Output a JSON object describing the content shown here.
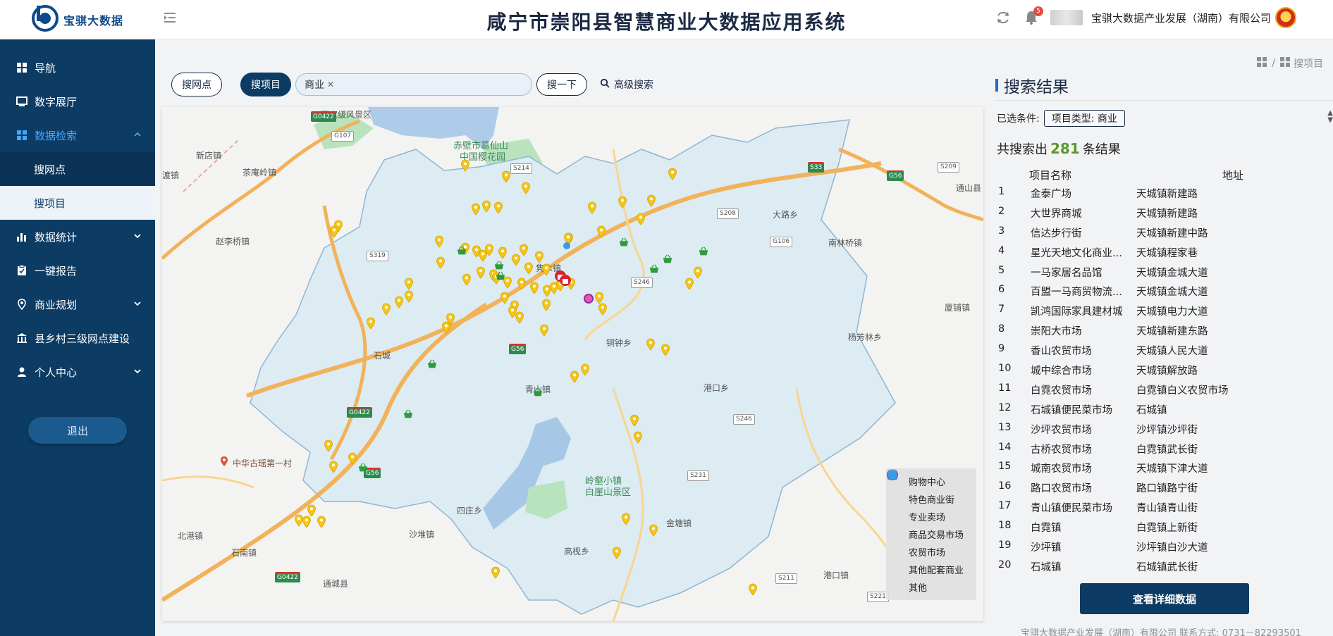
{
  "header": {
    "logo_text": "宝骐大数据",
    "title": "咸宁市崇阳县智慧商业大数据应用系统",
    "notification_count": "5",
    "company": "宝骐大数据产业发展（湖南）有限公司"
  },
  "sidebar": {
    "items": [
      {
        "label": "导航",
        "icon": "dashboard-icon"
      },
      {
        "label": "数字展厅",
        "icon": "monitor-icon"
      },
      {
        "label": "数据检索",
        "icon": "grid-icon",
        "expanded": true
      },
      {
        "label": "数据统计",
        "icon": "bar-chart-icon"
      },
      {
        "label": "一键报告",
        "icon": "clipboard-icon"
      },
      {
        "label": "商业规划",
        "icon": "location-pin-icon"
      },
      {
        "label": "县乡村三级网点建设",
        "icon": "bank-icon"
      },
      {
        "label": "个人中心",
        "icon": "user-icon"
      }
    ],
    "subitems": [
      {
        "label": "搜网点"
      },
      {
        "label": "搜项目",
        "active": true
      }
    ],
    "logout_label": "退出"
  },
  "breadcrumb": {
    "current": "搜项目"
  },
  "search": {
    "tab_outlets": "搜网点",
    "tab_projects": "搜项目",
    "tag": "商业",
    "go_label": "搜一下",
    "advanced_label": "高级搜索"
  },
  "map": {
    "places": [
      {
        "label": "国家级风景区"
      },
      {
        "label": "新店镇"
      },
      {
        "label": "渡镇"
      },
      {
        "label": "茶庵岭镇"
      },
      {
        "label": "赵李桥镇"
      },
      {
        "label": "赤壁市葛仙山"
      },
      {
        "label": "中国樱花园"
      },
      {
        "label": "大路乡"
      },
      {
        "label": "通山县"
      },
      {
        "label": "南林桥镇"
      },
      {
        "label": "厦铺镇"
      },
      {
        "label": "杨芳林乡"
      },
      {
        "label": "石城"
      },
      {
        "label": "铜钟乡"
      },
      {
        "label": "青山镇"
      },
      {
        "label": "港口乡"
      },
      {
        "label": "中华古瑶第一村"
      },
      {
        "label": "隽水镇"
      },
      {
        "label": "岭壑小镇"
      },
      {
        "label": "白崖山景区"
      },
      {
        "label": "四庄乡"
      },
      {
        "label": "北港镇"
      },
      {
        "label": "沙堆镇"
      },
      {
        "label": "石南镇"
      },
      {
        "label": "通城县"
      },
      {
        "label": "高枧乡"
      },
      {
        "label": "金塘镇"
      },
      {
        "label": "港口镇"
      }
    ],
    "roads": [
      "G0422",
      "G107",
      "S214",
      "S33",
      "G56",
      "S209",
      "S208",
      "G106",
      "S319",
      "S246",
      "G0422",
      "G56",
      "G56",
      "G0422",
      "S231",
      "S246",
      "S211",
      "S221"
    ],
    "legend": [
      {
        "label": "购物中心",
        "icon": "shopping-bag-icon",
        "color": "#d8232a"
      },
      {
        "label": "特色商业街",
        "icon": "storefront-icon",
        "color": "#2aa89a"
      },
      {
        "label": "专业卖场",
        "icon": "shop-icon",
        "color": "#f4a0a0"
      },
      {
        "label": "商品交易市场",
        "icon": "exchange-icon",
        "color": "#9c27b0"
      },
      {
        "label": "农贸市场",
        "icon": "basket-icon",
        "color": "#2e9b3a"
      },
      {
        "label": "其他配套商业",
        "icon": "map-pin-icon",
        "color": "#f5c518"
      },
      {
        "label": "其他",
        "icon": "dot-icon",
        "color": "#3a9bea"
      }
    ]
  },
  "results": {
    "title": "搜索结果",
    "filter_label": "已选条件:",
    "filter_tag": "项目类型: 商业",
    "count_prefix": "共搜索出",
    "count": "281",
    "count_suffix": "条结果",
    "col_name": "项目名称",
    "col_addr": "地址",
    "rows": [
      {
        "idx": "1",
        "name": "金泰广场",
        "addr": "天城镇新建路"
      },
      {
        "idx": "2",
        "name": "大世界商城",
        "addr": "天城镇新建路"
      },
      {
        "idx": "3",
        "name": "信达步行街",
        "addr": "天城镇新建中路"
      },
      {
        "idx": "4",
        "name": "星光天地文化商业...",
        "addr": "天城镇程家巷"
      },
      {
        "idx": "5",
        "name": "一马家居名品馆",
        "addr": "天城镇金城大道"
      },
      {
        "idx": "6",
        "name": "百盟一马商贸物流...",
        "addr": "天城镇金城大道"
      },
      {
        "idx": "7",
        "name": "凯鸿国际家具建材城",
        "addr": "天城镇电力大道"
      },
      {
        "idx": "8",
        "name": "崇阳大市场",
        "addr": "天城镇新建东路"
      },
      {
        "idx": "9",
        "name": "香山农贸市场",
        "addr": "天城镇人民大道"
      },
      {
        "idx": "10",
        "name": "城中综合市场",
        "addr": "天城镇解放路"
      },
      {
        "idx": "11",
        "name": "白霓农贸市场",
        "addr": "白霓镇白义农贸市场"
      },
      {
        "idx": "12",
        "name": "石城镇便民菜市场",
        "addr": "石城镇"
      },
      {
        "idx": "13",
        "name": "沙坪农贸市场",
        "addr": "沙坪镇沙坪街"
      },
      {
        "idx": "14",
        "name": "古桥农贸市场",
        "addr": "白霓镇武长街"
      },
      {
        "idx": "15",
        "name": "城南农贸市场",
        "addr": "天城镇下津大道"
      },
      {
        "idx": "16",
        "name": "路口农贸市场",
        "addr": "路口镇路宁街"
      },
      {
        "idx": "17",
        "name": "青山镇便民菜市场",
        "addr": "青山镇青山街"
      },
      {
        "idx": "18",
        "name": "白霓镇",
        "addr": "白霓镇上新街"
      },
      {
        "idx": "19",
        "name": "沙坪镇",
        "addr": "沙坪镇白沙大道"
      },
      {
        "idx": "20",
        "name": "石城镇",
        "addr": "石城镇武长街"
      }
    ],
    "detail_button": "查看详细数据",
    "footer": "宝骐大数据产业发展（湖南）有限公司 联系方式: 0731－82293501"
  }
}
